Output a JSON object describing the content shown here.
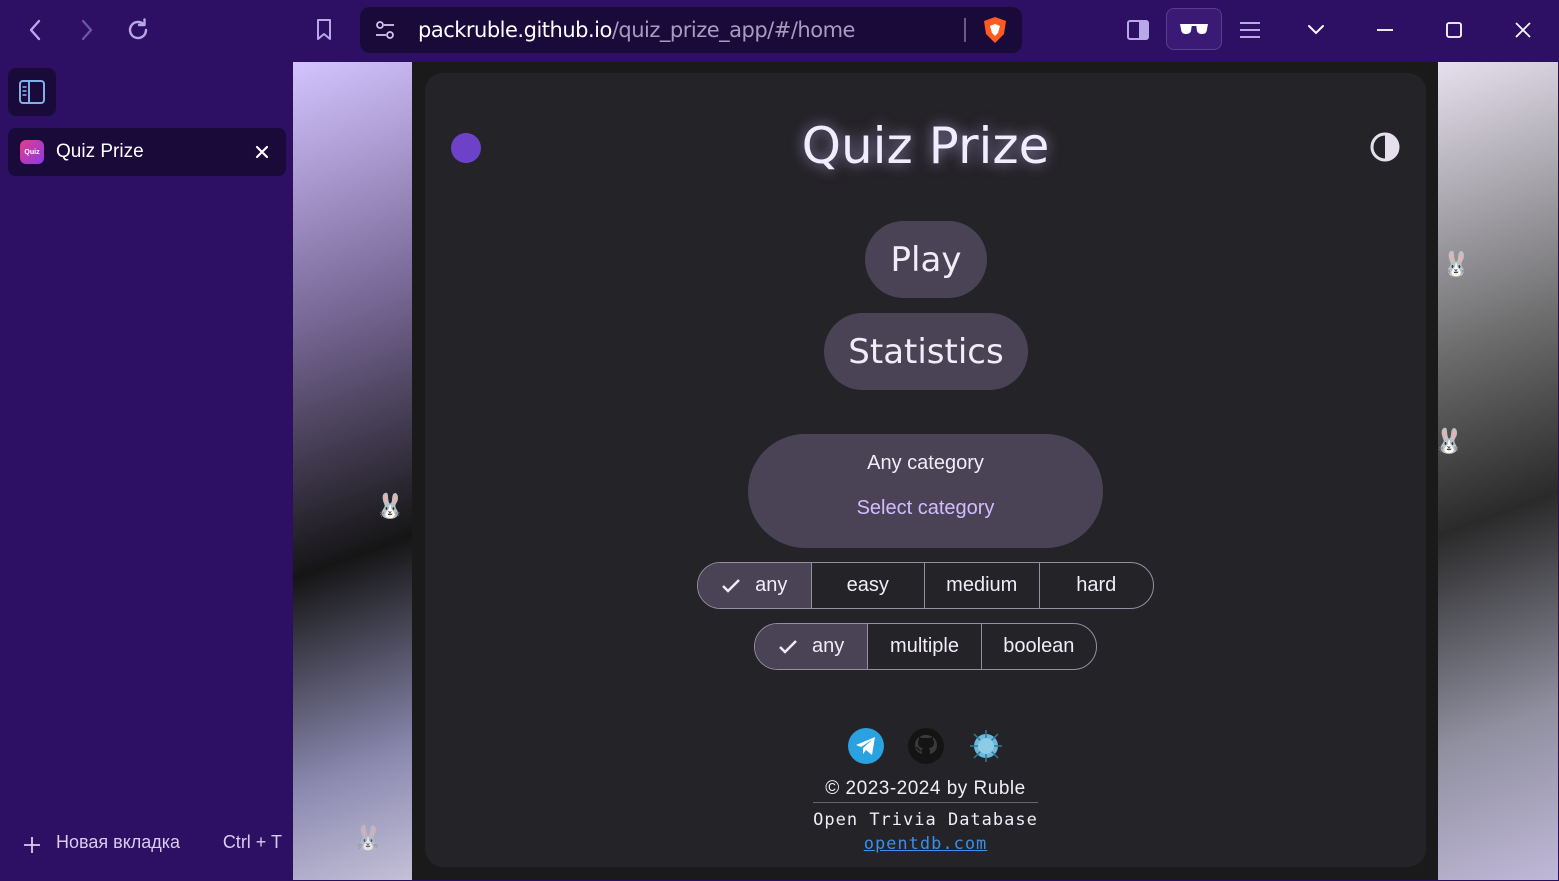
{
  "browser": {
    "url_host": "packruble.github.io",
    "url_path": "/quiz_prize_app/#/home",
    "icons": [
      "back-icon",
      "forward-icon",
      "reload-icon",
      "bookmark-icon",
      "site-settings-icon",
      "brave-shield-icon",
      "sidebar-toggle-icon",
      "reader-glasses-icon",
      "menu-icon",
      "chevron-down-icon",
      "minimize-icon",
      "maximize-icon",
      "close-icon"
    ]
  },
  "sidebar": {
    "tab": {
      "title": "Quiz Prize",
      "favicon_text": "Quiz"
    },
    "new_tab": {
      "label": "Новая вкладка",
      "shortcut": "Ctrl + T"
    }
  },
  "app": {
    "title": "Quiz Prize",
    "play_label": "Play",
    "statistics_label": "Statistics",
    "category": {
      "label": "Any category",
      "select": "Select category"
    },
    "difficulty": [
      "any",
      "easy",
      "medium",
      "hard"
    ],
    "difficulty_selected": "any",
    "type": [
      "any",
      "multiple",
      "boolean"
    ],
    "type_selected": "any",
    "footer": {
      "copyright": "© 2023-2024 by Ruble",
      "source": "Open Trivia Database",
      "link": "opentdb.com"
    },
    "colors": {
      "accent": "#6e42c8",
      "card": "#242327",
      "pill": "#4a4356",
      "link": "#3b8fe8"
    }
  }
}
